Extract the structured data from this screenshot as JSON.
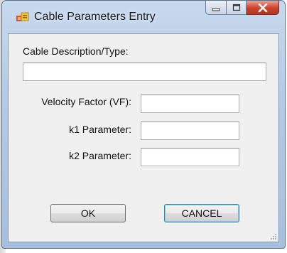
{
  "window": {
    "title": "Cable Parameters Entry",
    "icon": "windows-forms-app-icon"
  },
  "caption_buttons": {
    "minimize_icon": "minimize-icon",
    "maximize_icon": "maximize-icon",
    "close_icon": "close-icon"
  },
  "form": {
    "description_label": "Cable Description/Type:",
    "description_value": "",
    "vf_label": "Velocity Factor (VF):",
    "vf_value": "",
    "k1_label": "k1 Parameter:",
    "k1_value": "",
    "k2_label": "k2 Parameter:",
    "k2_value": ""
  },
  "buttons": {
    "ok_label": "OK",
    "cancel_label": "CANCEL"
  },
  "colors": {
    "title_bar": "#b3cae4",
    "client_background": "#f0f0f0",
    "close_button": "#c9432c",
    "default_button_border": "#3c7fb1"
  }
}
